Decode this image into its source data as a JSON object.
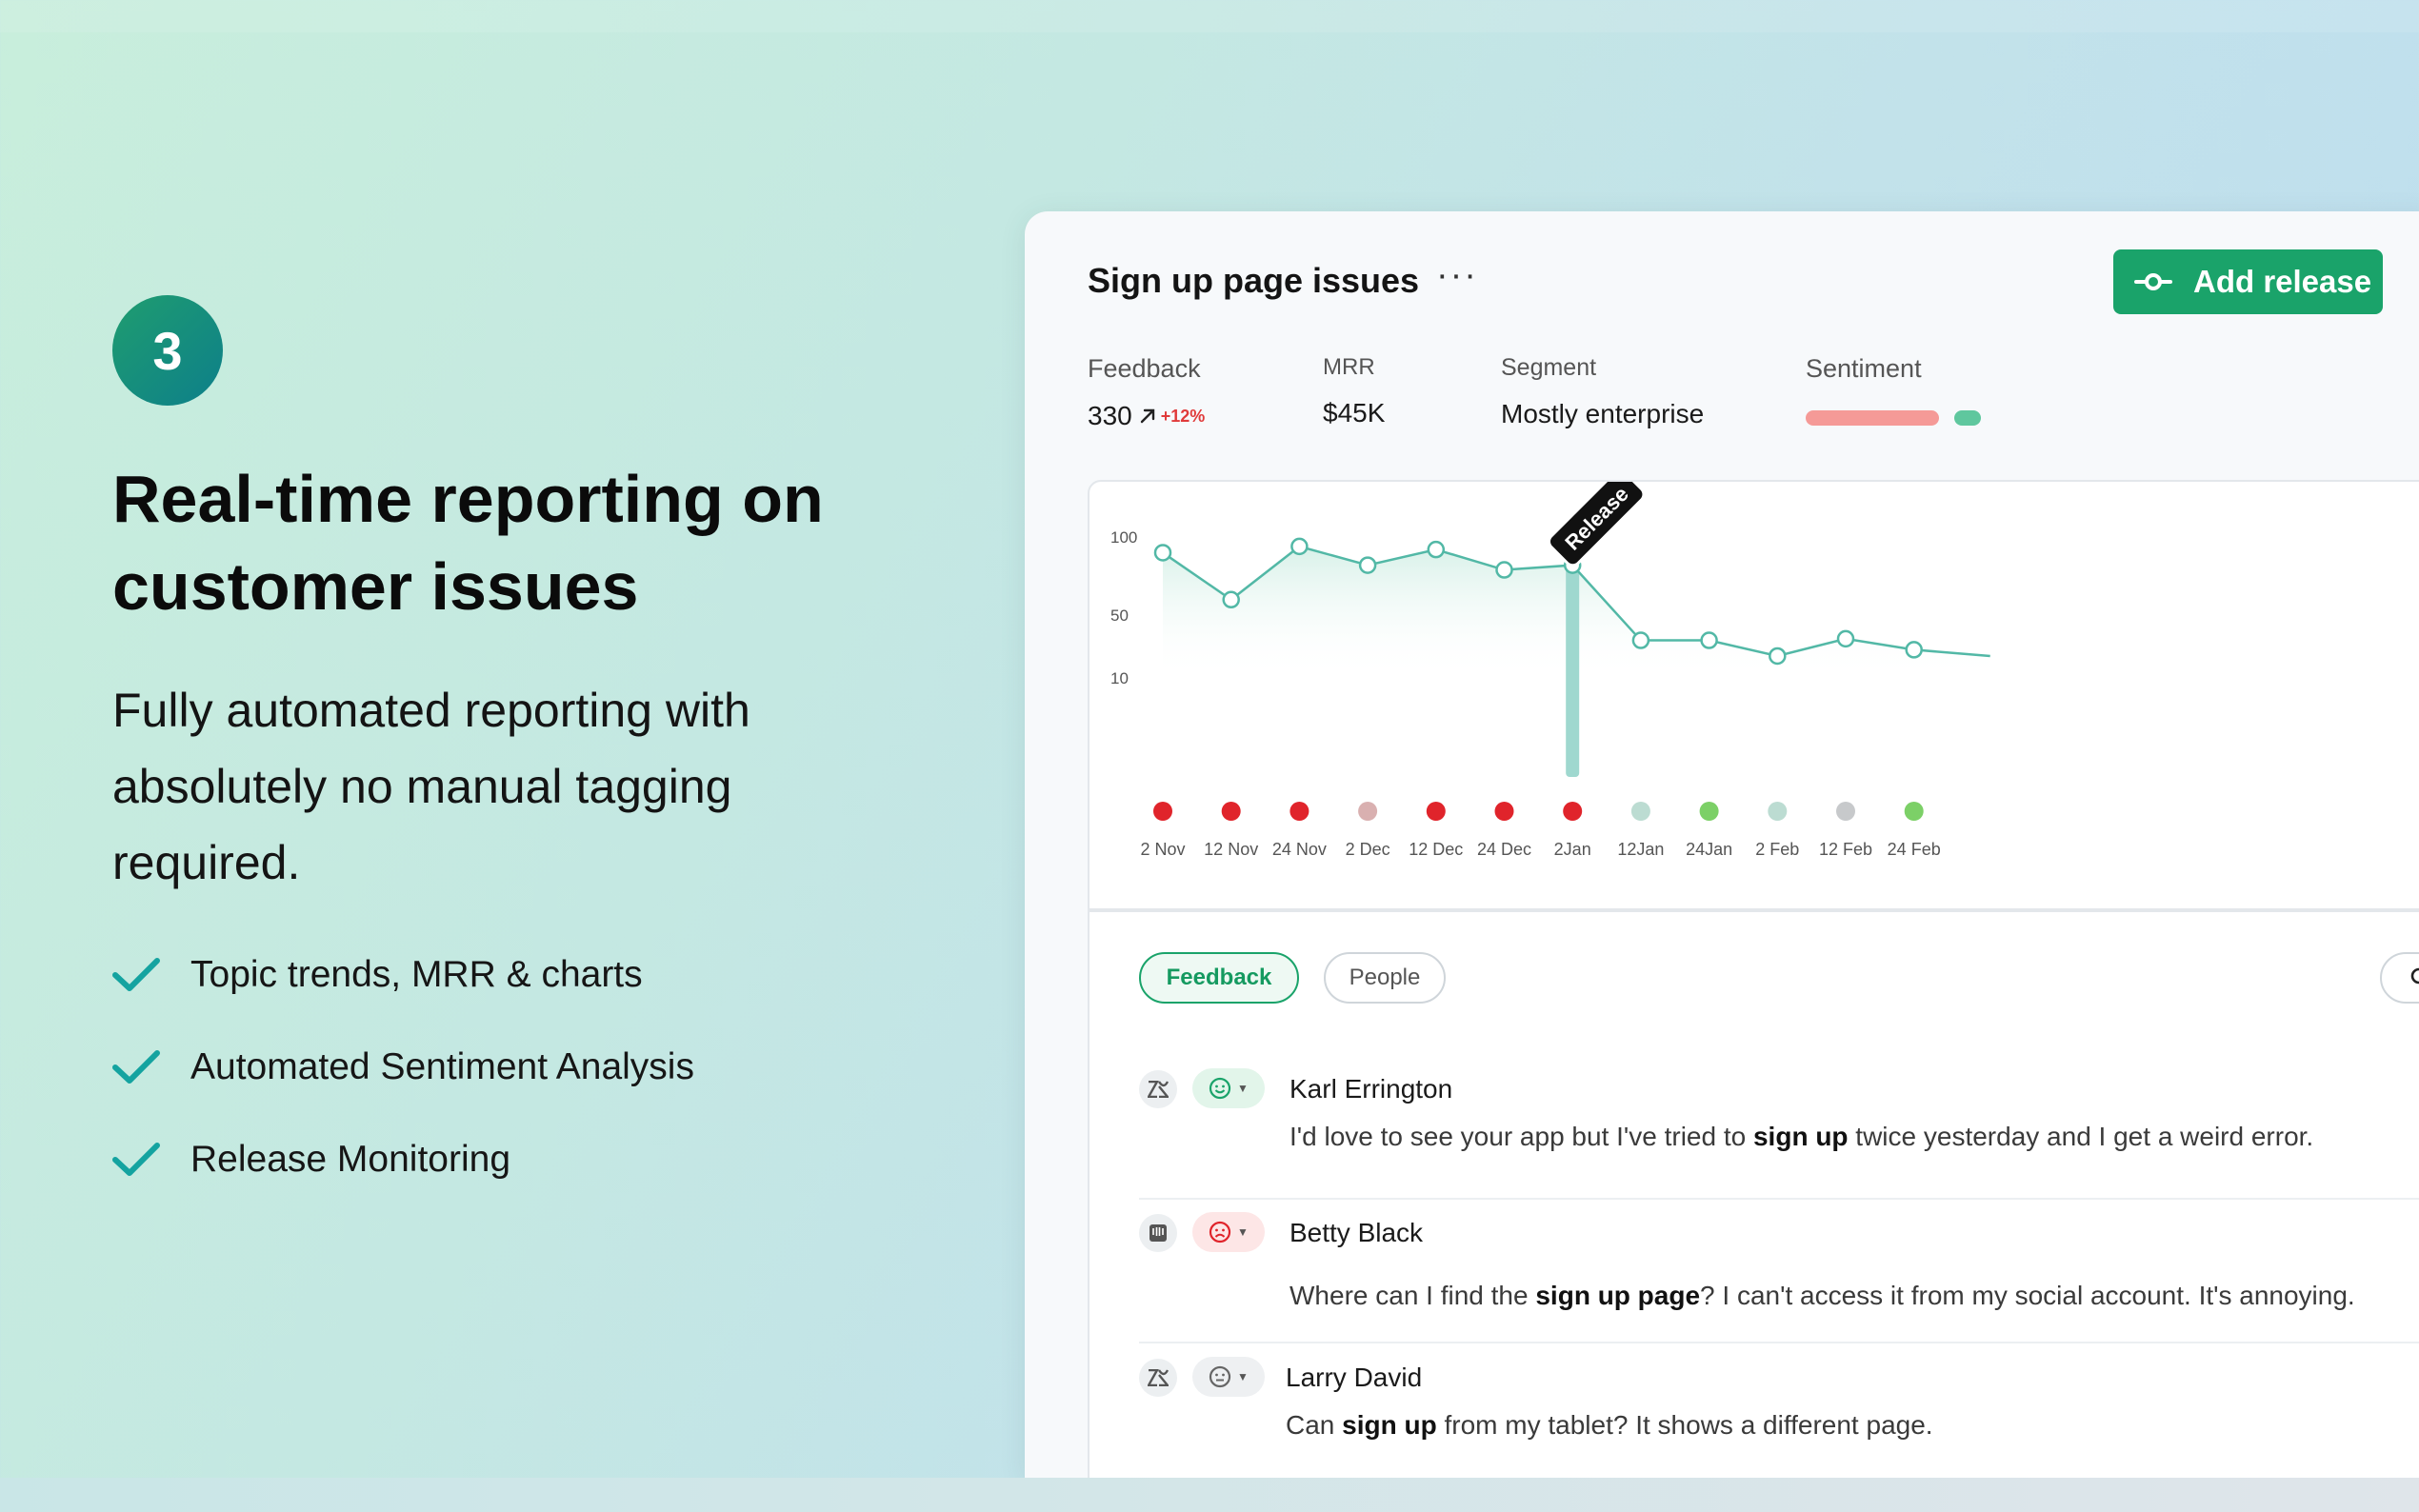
{
  "hero": {
    "step": "3",
    "headline_line1": "Real-time reporting on",
    "headline_line2": "customer issues",
    "subhead_line1": "Fully automated reporting with",
    "subhead_line2": "absolutely no manual tagging",
    "subhead_line3": "required.",
    "features": [
      "Topic trends, MRR & charts",
      "Automated Sentiment Analysis",
      "Release Monitoring"
    ]
  },
  "panel": {
    "title": "Sign up page issues",
    "more": "···",
    "add_release": "Add release",
    "stats": {
      "feedback_label": "Feedback",
      "feedback_value": "330",
      "feedback_trend": "+12%",
      "mrr_label": "MRR",
      "mrr_value": "$45K",
      "segment_label": "Segment",
      "segment_value": "Mostly enterprise",
      "sentiment_label": "Sentiment"
    },
    "tabs": [
      "Feedback",
      "People"
    ],
    "feed": [
      {
        "author": "Karl Errington",
        "source": "zendesk",
        "sentiment": "happy",
        "text_before": "I'd love to see your app but I've tried to ",
        "text_bold": "sign up",
        "text_after": " twice yesterday and I get a weird error."
      },
      {
        "author": "Betty Black",
        "source": "intercom",
        "sentiment": "sad",
        "text_before": "Where can I find the ",
        "text_bold": "sign up page",
        "text_after": "? I can't access it from my social account. It's annoying."
      },
      {
        "author": "Larry David",
        "source": "zendesk",
        "sentiment": "neutral",
        "text_before": "Can ",
        "text_bold": "sign up",
        "text_after": " from my tablet? It shows a different page."
      }
    ]
  },
  "colors": {
    "accent": "#1aa36a",
    "line": "#52b8a6",
    "negative": "#e0242b",
    "negative_light": "#d9b0b0",
    "positive": "#7cd067",
    "neutral": "#bcdcd2",
    "neutral_gray": "#c7c9cb"
  },
  "chart_data": {
    "type": "line",
    "categories": [
      "2 Nov",
      "12 Nov",
      "24 Nov",
      "2 Dec",
      "12 Dec",
      "24 Dec",
      "2Jan",
      "12Jan",
      "24Jan",
      "2 Feb",
      "12 Feb",
      "24 Feb"
    ],
    "values": [
      90,
      60,
      94,
      82,
      92,
      79,
      82,
      34,
      34,
      24,
      35,
      28
    ],
    "y_ticks": [
      100,
      50,
      10
    ],
    "ylim": [
      10,
      100
    ],
    "release_marker": {
      "label": "Release",
      "category": "2Jan"
    },
    "sentiment_dots": [
      "negative",
      "negative",
      "negative",
      "negative_light",
      "negative",
      "negative",
      "negative",
      "neutral",
      "positive",
      "neutral",
      "neutral_gray",
      "positive"
    ],
    "extends_right": true,
    "next_value": 24
  }
}
